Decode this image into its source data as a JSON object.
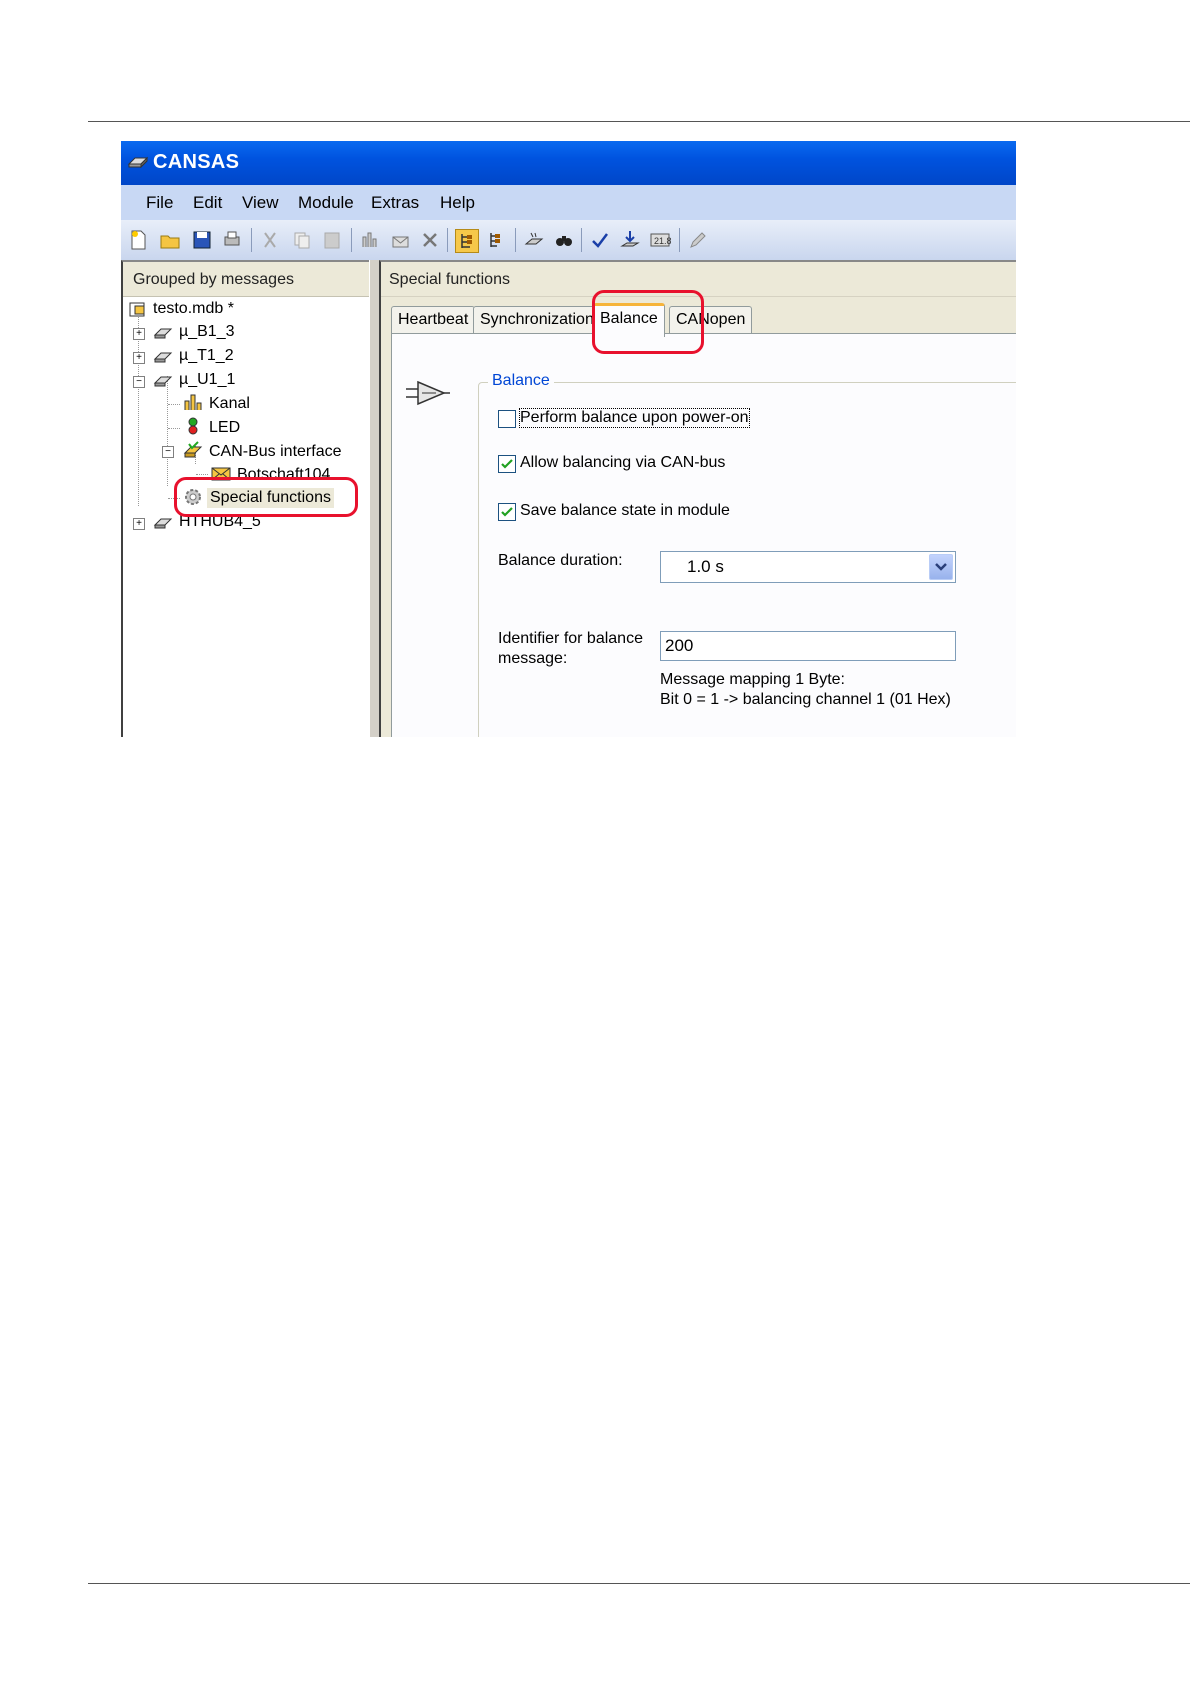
{
  "window": {
    "title": "CANSAS"
  },
  "menu": {
    "file": "File",
    "edit": "Edit",
    "view": "View",
    "module": "Module",
    "extras": "Extras",
    "help": "Help"
  },
  "tree": {
    "header": "Grouped by messages",
    "root": "testo.mdb *",
    "items": [
      "µ_B1_3",
      "µ_T1_2",
      "µ_U1_1",
      "Kanal",
      "LED",
      "CAN-Bus interface",
      "Botschaft104",
      "Special functions",
      "HTHUB4_5"
    ]
  },
  "right": {
    "header": "Special functions",
    "tabs": [
      "Heartbeat",
      "Synchronization",
      "Balance",
      "CANopen"
    ],
    "active_tab": "Balance",
    "group_title": "Balance",
    "checkboxes": [
      {
        "label": "Perform balance upon power-on",
        "checked": false
      },
      {
        "label": "Allow balancing via CAN-bus",
        "checked": true
      },
      {
        "label": "Save balance state in module",
        "checked": true
      }
    ],
    "duration_label": "Balance duration:",
    "duration_value": "1.0  s",
    "identifier_label_1": "Identifier for balance",
    "identifier_label_2": "message:",
    "identifier_value": "200",
    "mapping_line_1": "Message mapping 1 Byte:",
    "mapping_line_2": "Bit 0 = 1 -> balancing channel 1 (01 Hex)"
  },
  "colors": {
    "title_blue": "#0053df",
    "highlight_red": "#e8112d",
    "group_title": "#0046d5"
  }
}
